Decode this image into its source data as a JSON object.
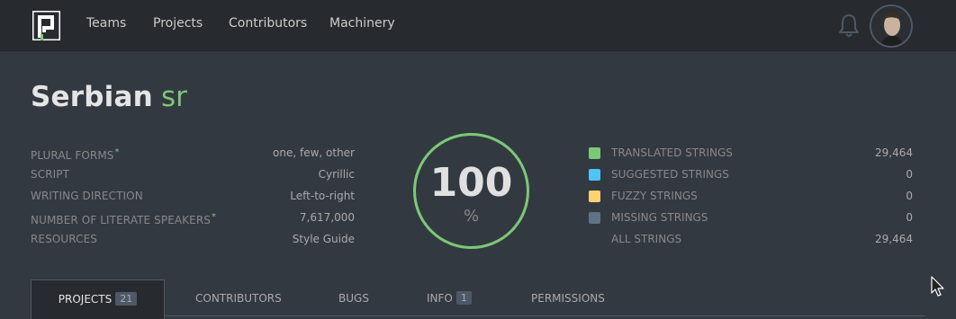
{
  "nav": {
    "links": [
      "Teams",
      "Projects",
      "Contributors",
      "Machinery"
    ]
  },
  "icons": {
    "logo": "pontoon-logo-icon",
    "notifications": "bell-icon",
    "avatar": "user-avatar"
  },
  "locale": {
    "name": "Serbian",
    "code": "sr"
  },
  "info": [
    {
      "label": "PLURAL FORMS",
      "asterisk": "*",
      "value": "one, few, other"
    },
    {
      "label": "SCRIPT",
      "asterisk": "",
      "value": "Cyrillic"
    },
    {
      "label": "WRITING DIRECTION",
      "asterisk": "",
      "value": "Left-to-right"
    },
    {
      "label": "NUMBER OF LITERATE SPEAKERS",
      "asterisk": "*",
      "value": "7,617,000"
    },
    {
      "label": "RESOURCES",
      "asterisk": "",
      "value": "Style Guide"
    }
  ],
  "progress": {
    "percent": "100",
    "unit": "%",
    "fraction": 1.0
  },
  "stats": [
    {
      "label": "TRANSLATED STRINGS",
      "value": "29,464",
      "color": "#7bc876"
    },
    {
      "label": "SUGGESTED STRINGS",
      "value": "0",
      "color": "#4fc4f6"
    },
    {
      "label": "FUZZY STRINGS",
      "value": "0",
      "color": "#fed271"
    },
    {
      "label": "MISSING STRINGS",
      "value": "0",
      "color": "#5f7285"
    },
    {
      "label": "ALL STRINGS",
      "value": "29,464",
      "color": ""
    }
  ],
  "tabs": [
    {
      "label": "PROJECTS",
      "count": "21"
    },
    {
      "label": "CONTRIBUTORS",
      "count": ""
    },
    {
      "label": "BUGS",
      "count": ""
    },
    {
      "label": "INFO",
      "count": "1"
    },
    {
      "label": "PERMISSIONS",
      "count": ""
    }
  ],
  "colors": {
    "accent": "#7bc876",
    "nav_bg": "#272a2f",
    "page_bg": "#333941"
  }
}
